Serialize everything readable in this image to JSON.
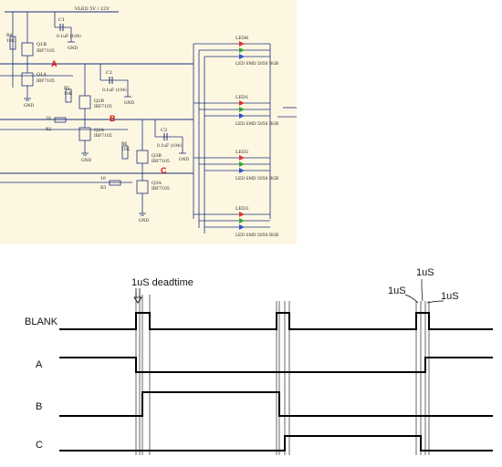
{
  "schematic": {
    "supply_label": "VLED 5V / 12V",
    "net_labels": [
      "A",
      "B",
      "C"
    ],
    "label_color": "#dd1111",
    "wire_color": "#1c2f7a",
    "bg_color": "#fdf7e2",
    "capacitors": [
      {
        "ref": "C1",
        "value": "0.1uF (104)",
        "gnd": "GND"
      },
      {
        "ref": "C2",
        "value": "0.1uF (104)",
        "gnd": "GND"
      },
      {
        "ref": "C3",
        "value": "0.1uF (104)",
        "gnd": "GND"
      }
    ],
    "fets": [
      {
        "top_ref": "Q1B",
        "bot_ref": "Q1A",
        "part": "IRF7105",
        "r_ref": "R4",
        "r_val": "10K",
        "gate_r": "",
        "gate_r_val": ""
      },
      {
        "top_ref": "Q2B",
        "bot_ref": "Q2A",
        "part": "IRF7105",
        "r_ref": "R5",
        "r_val": "10K",
        "gate_r": "R2",
        "gate_r_val": "10"
      },
      {
        "top_ref": "Q3B",
        "bot_ref": "Q3A",
        "part": "IRF7105",
        "r_ref": "R6",
        "r_val": "10K",
        "gate_r": "R3",
        "gate_r_val": "10"
      }
    ],
    "leds": [
      {
        "ref": "LED6",
        "part": "LED SMD 5050 RGB"
      },
      {
        "ref": "LED1",
        "part": "LED SMD 5050 RGB"
      },
      {
        "ref": "LED2",
        "part": "LED SMD 5050 RGB"
      },
      {
        "ref": "LED3",
        "part": "LED SMD 5050 RGB"
      }
    ],
    "gnd_label": "GND"
  },
  "timing": {
    "signals": [
      "BLANK",
      "A",
      "B",
      "C"
    ],
    "deadtime_label": "1uS deadtime",
    "callout_labels": [
      "1uS",
      "1uS",
      "1uS"
    ]
  }
}
